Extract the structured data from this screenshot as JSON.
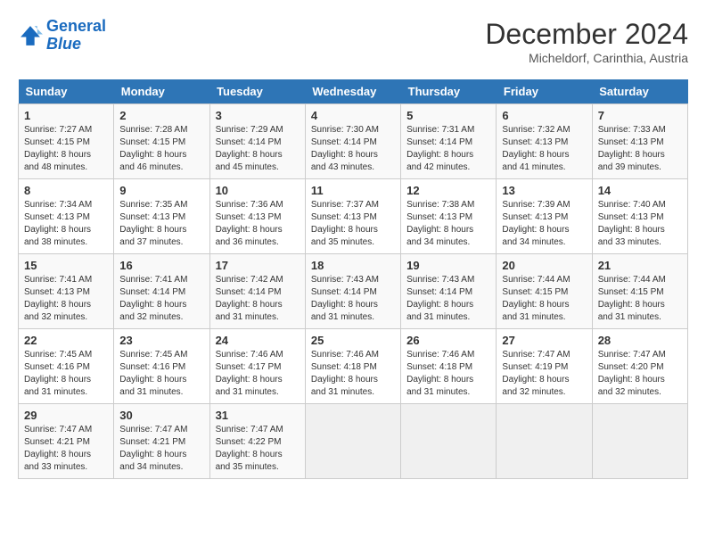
{
  "logo": {
    "line1": "General",
    "line2": "Blue"
  },
  "title": "December 2024",
  "subtitle": "Micheldorf, Carinthia, Austria",
  "days_of_week": [
    "Sunday",
    "Monday",
    "Tuesday",
    "Wednesday",
    "Thursday",
    "Friday",
    "Saturday"
  ],
  "weeks": [
    [
      {
        "day": 1,
        "sunrise": "Sunrise: 7:27 AM",
        "sunset": "Sunset: 4:15 PM",
        "daylight": "Daylight: 8 hours and 48 minutes."
      },
      {
        "day": 2,
        "sunrise": "Sunrise: 7:28 AM",
        "sunset": "Sunset: 4:15 PM",
        "daylight": "Daylight: 8 hours and 46 minutes."
      },
      {
        "day": 3,
        "sunrise": "Sunrise: 7:29 AM",
        "sunset": "Sunset: 4:14 PM",
        "daylight": "Daylight: 8 hours and 45 minutes."
      },
      {
        "day": 4,
        "sunrise": "Sunrise: 7:30 AM",
        "sunset": "Sunset: 4:14 PM",
        "daylight": "Daylight: 8 hours and 43 minutes."
      },
      {
        "day": 5,
        "sunrise": "Sunrise: 7:31 AM",
        "sunset": "Sunset: 4:14 PM",
        "daylight": "Daylight: 8 hours and 42 minutes."
      },
      {
        "day": 6,
        "sunrise": "Sunrise: 7:32 AM",
        "sunset": "Sunset: 4:13 PM",
        "daylight": "Daylight: 8 hours and 41 minutes."
      },
      {
        "day": 7,
        "sunrise": "Sunrise: 7:33 AM",
        "sunset": "Sunset: 4:13 PM",
        "daylight": "Daylight: 8 hours and 39 minutes."
      }
    ],
    [
      {
        "day": 8,
        "sunrise": "Sunrise: 7:34 AM",
        "sunset": "Sunset: 4:13 PM",
        "daylight": "Daylight: 8 hours and 38 minutes."
      },
      {
        "day": 9,
        "sunrise": "Sunrise: 7:35 AM",
        "sunset": "Sunset: 4:13 PM",
        "daylight": "Daylight: 8 hours and 37 minutes."
      },
      {
        "day": 10,
        "sunrise": "Sunrise: 7:36 AM",
        "sunset": "Sunset: 4:13 PM",
        "daylight": "Daylight: 8 hours and 36 minutes."
      },
      {
        "day": 11,
        "sunrise": "Sunrise: 7:37 AM",
        "sunset": "Sunset: 4:13 PM",
        "daylight": "Daylight: 8 hours and 35 minutes."
      },
      {
        "day": 12,
        "sunrise": "Sunrise: 7:38 AM",
        "sunset": "Sunset: 4:13 PM",
        "daylight": "Daylight: 8 hours and 34 minutes."
      },
      {
        "day": 13,
        "sunrise": "Sunrise: 7:39 AM",
        "sunset": "Sunset: 4:13 PM",
        "daylight": "Daylight: 8 hours and 34 minutes."
      },
      {
        "day": 14,
        "sunrise": "Sunrise: 7:40 AM",
        "sunset": "Sunset: 4:13 PM",
        "daylight": "Daylight: 8 hours and 33 minutes."
      }
    ],
    [
      {
        "day": 15,
        "sunrise": "Sunrise: 7:41 AM",
        "sunset": "Sunset: 4:13 PM",
        "daylight": "Daylight: 8 hours and 32 minutes."
      },
      {
        "day": 16,
        "sunrise": "Sunrise: 7:41 AM",
        "sunset": "Sunset: 4:14 PM",
        "daylight": "Daylight: 8 hours and 32 minutes."
      },
      {
        "day": 17,
        "sunrise": "Sunrise: 7:42 AM",
        "sunset": "Sunset: 4:14 PM",
        "daylight": "Daylight: 8 hours and 31 minutes."
      },
      {
        "day": 18,
        "sunrise": "Sunrise: 7:43 AM",
        "sunset": "Sunset: 4:14 PM",
        "daylight": "Daylight: 8 hours and 31 minutes."
      },
      {
        "day": 19,
        "sunrise": "Sunrise: 7:43 AM",
        "sunset": "Sunset: 4:14 PM",
        "daylight": "Daylight: 8 hours and 31 minutes."
      },
      {
        "day": 20,
        "sunrise": "Sunrise: 7:44 AM",
        "sunset": "Sunset: 4:15 PM",
        "daylight": "Daylight: 8 hours and 31 minutes."
      },
      {
        "day": 21,
        "sunrise": "Sunrise: 7:44 AM",
        "sunset": "Sunset: 4:15 PM",
        "daylight": "Daylight: 8 hours and 31 minutes."
      }
    ],
    [
      {
        "day": 22,
        "sunrise": "Sunrise: 7:45 AM",
        "sunset": "Sunset: 4:16 PM",
        "daylight": "Daylight: 8 hours and 31 minutes."
      },
      {
        "day": 23,
        "sunrise": "Sunrise: 7:45 AM",
        "sunset": "Sunset: 4:16 PM",
        "daylight": "Daylight: 8 hours and 31 minutes."
      },
      {
        "day": 24,
        "sunrise": "Sunrise: 7:46 AM",
        "sunset": "Sunset: 4:17 PM",
        "daylight": "Daylight: 8 hours and 31 minutes."
      },
      {
        "day": 25,
        "sunrise": "Sunrise: 7:46 AM",
        "sunset": "Sunset: 4:18 PM",
        "daylight": "Daylight: 8 hours and 31 minutes."
      },
      {
        "day": 26,
        "sunrise": "Sunrise: 7:46 AM",
        "sunset": "Sunset: 4:18 PM",
        "daylight": "Daylight: 8 hours and 31 minutes."
      },
      {
        "day": 27,
        "sunrise": "Sunrise: 7:47 AM",
        "sunset": "Sunset: 4:19 PM",
        "daylight": "Daylight: 8 hours and 32 minutes."
      },
      {
        "day": 28,
        "sunrise": "Sunrise: 7:47 AM",
        "sunset": "Sunset: 4:20 PM",
        "daylight": "Daylight: 8 hours and 32 minutes."
      }
    ],
    [
      {
        "day": 29,
        "sunrise": "Sunrise: 7:47 AM",
        "sunset": "Sunset: 4:21 PM",
        "daylight": "Daylight: 8 hours and 33 minutes."
      },
      {
        "day": 30,
        "sunrise": "Sunrise: 7:47 AM",
        "sunset": "Sunset: 4:21 PM",
        "daylight": "Daylight: 8 hours and 34 minutes."
      },
      {
        "day": 31,
        "sunrise": "Sunrise: 7:47 AM",
        "sunset": "Sunset: 4:22 PM",
        "daylight": "Daylight: 8 hours and 35 minutes."
      },
      null,
      null,
      null,
      null
    ]
  ]
}
